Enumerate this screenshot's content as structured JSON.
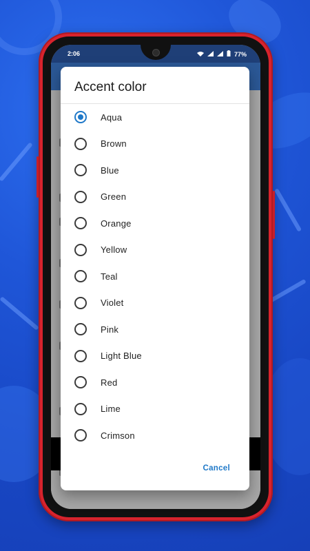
{
  "status_bar": {
    "time": "2:06",
    "battery": "77%"
  },
  "dialog": {
    "title": "Accent color",
    "selected": "Aqua",
    "options": [
      "Aqua",
      "Brown",
      "Blue",
      "Green",
      "Orange",
      "Yellow",
      "Teal",
      "Violet",
      "Pink",
      "Light Blue",
      "Red",
      "Lime",
      "Crimson"
    ],
    "cancel_label": "Cancel"
  },
  "colors": {
    "accent": "#1e78c8",
    "status_bar": "#1f3f77",
    "phone_frame": "#d8232d"
  }
}
